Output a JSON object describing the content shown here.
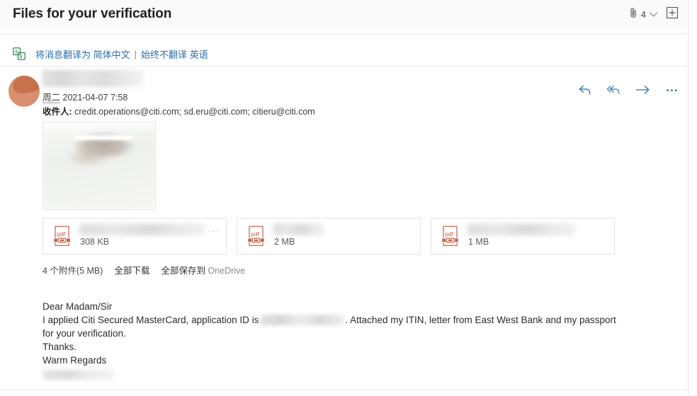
{
  "header": {
    "subject": "Files for your verification",
    "attachment_count": "4",
    "attach_icon": "paperclip-icon",
    "chevron_icon": "chevron-down-icon",
    "popout_icon": "open-in-new-window-icon"
  },
  "translate_bar": {
    "icon": "translate-icon",
    "translate_prefix": "将消息翻译为",
    "translate_target": "简体中文",
    "separator": "|",
    "never_translate_prefix": "始终不翻译",
    "never_translate_lang": "英语"
  },
  "message": {
    "sender_name": "",
    "avatar": "sender-avatar",
    "day_of_week": "周二",
    "date": "2021-04-07",
    "time": "7:58",
    "recipients_label": "收件人:",
    "recipients": "credit.operations@citi.com; sd.eru@citi.com; citieru@citi.com",
    "actions": {
      "reply": "reply-icon",
      "reply_all": "reply-all-icon",
      "forward": "forward-icon",
      "more": "..."
    }
  },
  "inline_image": {
    "name": "inline-image-preview"
  },
  "attachments": {
    "items": [
      {
        "type": "pdf",
        "filename": "",
        "size": "308 KB",
        "menu": "···",
        "blur_width": "w1",
        "has_menu": true
      },
      {
        "type": "pdf",
        "filename": "",
        "size": "2 MB",
        "menu": "···",
        "blur_width": "w2",
        "has_menu": false
      },
      {
        "type": "pdf",
        "filename": "",
        "size": "1 MB",
        "menu": "···",
        "blur_width": "w3",
        "has_menu": false
      }
    ],
    "summary": {
      "count_text": "4 个附件(5 MB)",
      "download_all": "全部下载",
      "save_all_prefix": "全部保存到",
      "save_all_target": "OneDrive"
    }
  },
  "body": {
    "line1": "Dear Madam/Sir",
    "line2_before": "I applied Citi Secured MasterCard, application ID is",
    "line2_redacted": "",
    "line2_after": ". Attached my ITIN, letter from East West Bank and my passport",
    "line3": "for your verification.",
    "line4": "Thanks.",
    "line5": "Warm Regards",
    "signature": ""
  },
  "colors": {
    "link_blue": "#2a6ea8",
    "translate_green": "#1f7a3d",
    "pdf_red": "#c4604a",
    "avatar": "#d98f6e",
    "subject_bg": "#fafafa"
  }
}
